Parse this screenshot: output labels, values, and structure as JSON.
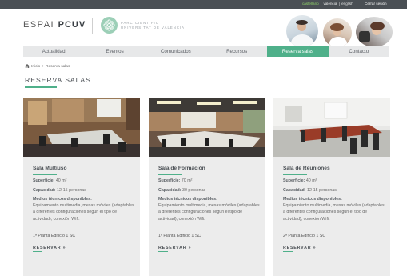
{
  "topbar": {
    "lang_active": "castellano",
    "lang_2": "valencià",
    "lang_3": "english",
    "separator": "|",
    "close_session": "Cerrar sesión"
  },
  "header": {
    "logo_light": "ESPAI",
    "logo_bold": "PCUV",
    "pcuv_line1": "PARC CIENTÍFIC",
    "pcuv_line2": "UNIVERSITAT DE VALÈNCIA"
  },
  "nav": {
    "items": [
      {
        "label": "Actualidad",
        "active": false
      },
      {
        "label": "Eventos",
        "active": false
      },
      {
        "label": "Comunicados",
        "active": false
      },
      {
        "label": "Recursos",
        "active": false
      },
      {
        "label": "Reserva salas",
        "active": true
      },
      {
        "label": "Contacto",
        "active": false
      }
    ]
  },
  "breadcrumb": {
    "home": "Inicio",
    "separator": ">",
    "current": "Reserva salas"
  },
  "page": {
    "title": "RESERVA SALAS"
  },
  "cards": [
    {
      "title": "Sala Multiuso",
      "surface_label": "Superficie:",
      "surface_value": "40 m²",
      "capacity_label": "Capacidad:",
      "capacity_value": "12-15 personas",
      "resources_label": "Medios técnicos disponibles:",
      "resources_text": "Equipamiento multimedia, mesas móviles (adaptables a diferentes configuraciones según el tipo de actividad), conexión Wifi.",
      "location": "1ª Planta Edificio 1 SC",
      "reserve": "RESERVAR »"
    },
    {
      "title": "Sala de Formación",
      "surface_label": "Superficie:",
      "surface_value": "70 m²",
      "capacity_label": "Capacidad:",
      "capacity_value": "30 personas",
      "resources_label": "Medios técnicos disponibles:",
      "resources_text": "Equipamiento multimedia, mesas móviles (adaptables a diferentes configuraciones según el tipo de actividad), conexión Wifi.",
      "location": "1ª Planta Edificio 1 SC",
      "reserve": "RESERVAR »"
    },
    {
      "title": "Sala de Reuniones",
      "surface_label": "Superficie:",
      "surface_value": "40 m²",
      "capacity_label": "Capacidad:",
      "capacity_value": "12-15 personas",
      "resources_label": "Medios técnicos disponibles:",
      "resources_text": "Equipamiento multimedia, mesas móviles (adaptables a diferentes configuraciones según el tipo de actividad), conexión Wifi.",
      "location": "2ª Planta Edificio 1 SC",
      "reserve": "RESERVAR »"
    }
  ],
  "colors": {
    "accent": "#4fb08a",
    "topbar": "#4a4f54",
    "nav_bg": "#e7e8e9",
    "card_bg": "#ececec"
  }
}
